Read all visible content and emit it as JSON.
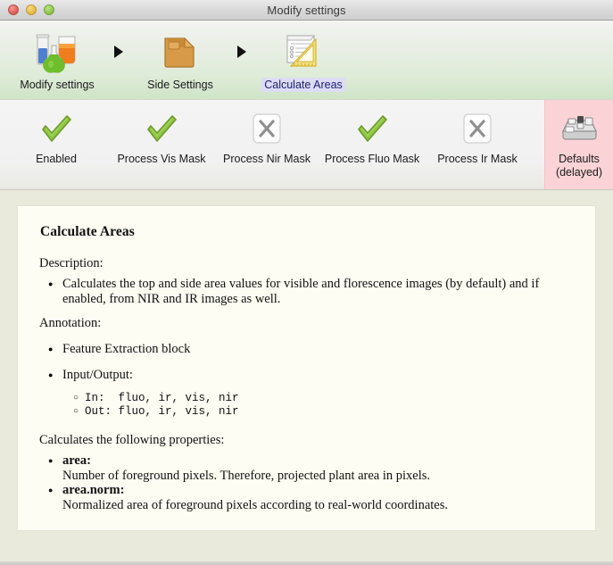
{
  "window": {
    "title": "Modify settings",
    "traffic_lights": [
      "close-button",
      "minimize-button",
      "zoom-button"
    ]
  },
  "breadcrumb": {
    "items": [
      {
        "label": "Modify settings",
        "icon": "lab-glassware-icon",
        "selected": false
      },
      {
        "label": "Side Settings",
        "icon": "folder-icon",
        "selected": false
      },
      {
        "label": "Calculate Areas",
        "icon": "ruler-document-icon",
        "selected": true
      }
    ],
    "separator_icon": "triangle-right-icon"
  },
  "toolbar": {
    "items": [
      {
        "label": "Enabled",
        "state": "on",
        "icon": "green-check-icon"
      },
      {
        "label": "Process Vis Mask",
        "state": "on",
        "icon": "green-check-icon"
      },
      {
        "label": "Process Nir Mask",
        "state": "off",
        "icon": "gray-cross-icon"
      },
      {
        "label": "Process Fluo Mask",
        "state": "on",
        "icon": "green-check-icon"
      },
      {
        "label": "Process Ir Mask",
        "state": "off",
        "icon": "gray-cross-icon"
      }
    ],
    "defaults": {
      "label_line1": "Defaults",
      "label_line2": "(delayed)",
      "icon": "mixer-panel-icon",
      "background_color": "#fbd3d6"
    }
  },
  "document": {
    "heading": "Calculate Areas",
    "description_label": "Description:",
    "description_bullets": [
      "Calculates the top and side area values for visible and florescence images (by default) and if enabled, from NIR and IR images as well."
    ],
    "annotation_label": "Annotation:",
    "annotation_bullets": [
      "Feature Extraction block",
      "Input/Output:"
    ],
    "io": {
      "in_line": "In:  fluo, ir, vis, nir",
      "out_line": "Out: fluo, ir, vis, nir"
    },
    "properties_intro": "Calculates the following properties:",
    "properties": [
      {
        "name": "area:",
        "description": "Number of foreground pixels. Therefore, projected plant area in pixels."
      },
      {
        "name": "area.norm:",
        "description": "Normalized area of foreground pixels according to real-world coordinates."
      }
    ]
  },
  "colors": {
    "title_bar": "#d8d8d8",
    "breadcrumb_gradient_bottom": "#cfe4c8",
    "toolbar": "#f1f1f1",
    "defaults_pink": "#fbd3d6",
    "content_beige": "#e9e9dc",
    "doc_paper": "#fdfdf3",
    "selected_label_bg": "#dcdcf7",
    "check_green": "#7cb342",
    "cross_gray": "#9a9a9a"
  }
}
